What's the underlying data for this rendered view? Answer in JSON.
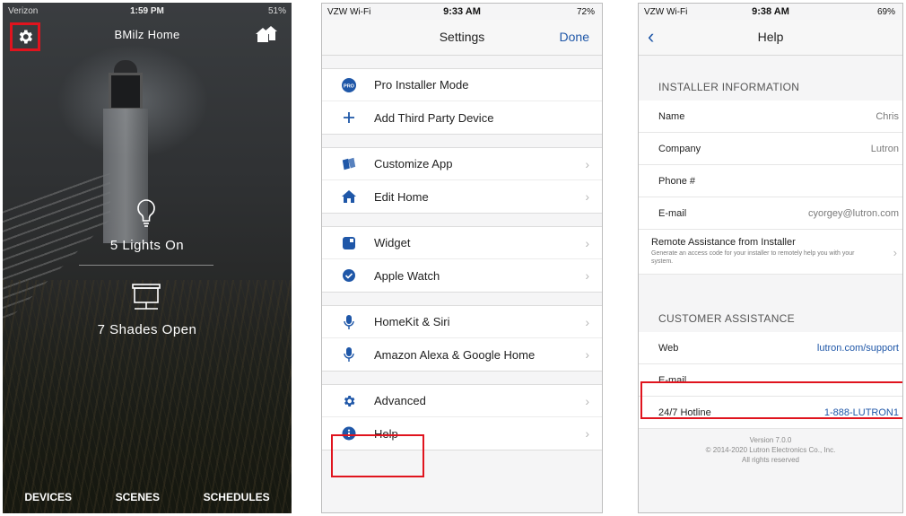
{
  "home": {
    "status": {
      "carrier": "Verizon",
      "time": "1:59 PM",
      "battery": "51%"
    },
    "title": "BMilz Home",
    "lights_label": "5 Lights On",
    "shades_label": "7 Shades Open",
    "tabs": [
      "DEVICES",
      "SCENES",
      "SCHEDULES"
    ]
  },
  "settings": {
    "status": {
      "carrier": "VZW Wi-Fi",
      "time": "9:33 AM",
      "battery": "72%"
    },
    "title": "Settings",
    "done_label": "Done",
    "groups": [
      [
        {
          "label": "Pro Installer Mode",
          "icon": "pro-badge-icon"
        },
        {
          "label": "Add Third Party Device",
          "icon": "plus-icon"
        }
      ],
      [
        {
          "label": "Customize App",
          "icon": "cards-icon"
        },
        {
          "label": "Edit Home",
          "icon": "home-icon"
        }
      ],
      [
        {
          "label": "Widget",
          "icon": "widget-icon"
        },
        {
          "label": "Apple Watch",
          "icon": "watch-icon"
        }
      ],
      [
        {
          "label": "HomeKit & Siri",
          "icon": "microphone-icon"
        },
        {
          "label": "Amazon Alexa & Google Home",
          "icon": "microphone-icon"
        }
      ],
      [
        {
          "label": "Advanced",
          "icon": "gear-icon"
        },
        {
          "label": "Help",
          "icon": "info-icon"
        }
      ]
    ]
  },
  "help": {
    "status": {
      "carrier": "VZW Wi-Fi",
      "time": "9:38 AM",
      "battery": "69%"
    },
    "title": "Help",
    "installer_header": "INSTALLER INFORMATION",
    "installer_rows": [
      {
        "label": "Name",
        "value": "Chris"
      },
      {
        "label": "Company",
        "value": "Lutron"
      },
      {
        "label": "Phone #",
        "value": ""
      },
      {
        "label": "E-mail",
        "value": "cyorgey@lutron.com"
      }
    ],
    "remote": {
      "title": "Remote Assistance from Installer",
      "desc": "Generate an access code for your installer to remotely help you with your system."
    },
    "customer_header": "CUSTOMER ASSISTANCE",
    "web_label": "Web",
    "web_value": "lutron.com/support",
    "email_label": "E-mail",
    "hotline_label": "24/7 Hotline",
    "hotline_value": "1-888-LUTRON1",
    "version": "Version 7.0.0",
    "copyright": "© 2014-2020 Lutron Electronics Co., Inc.",
    "rights": "All rights reserved"
  },
  "colors": {
    "highlight": "#e0141e",
    "link": "#1f57a8",
    "icon_blue": "#1f57a8"
  }
}
